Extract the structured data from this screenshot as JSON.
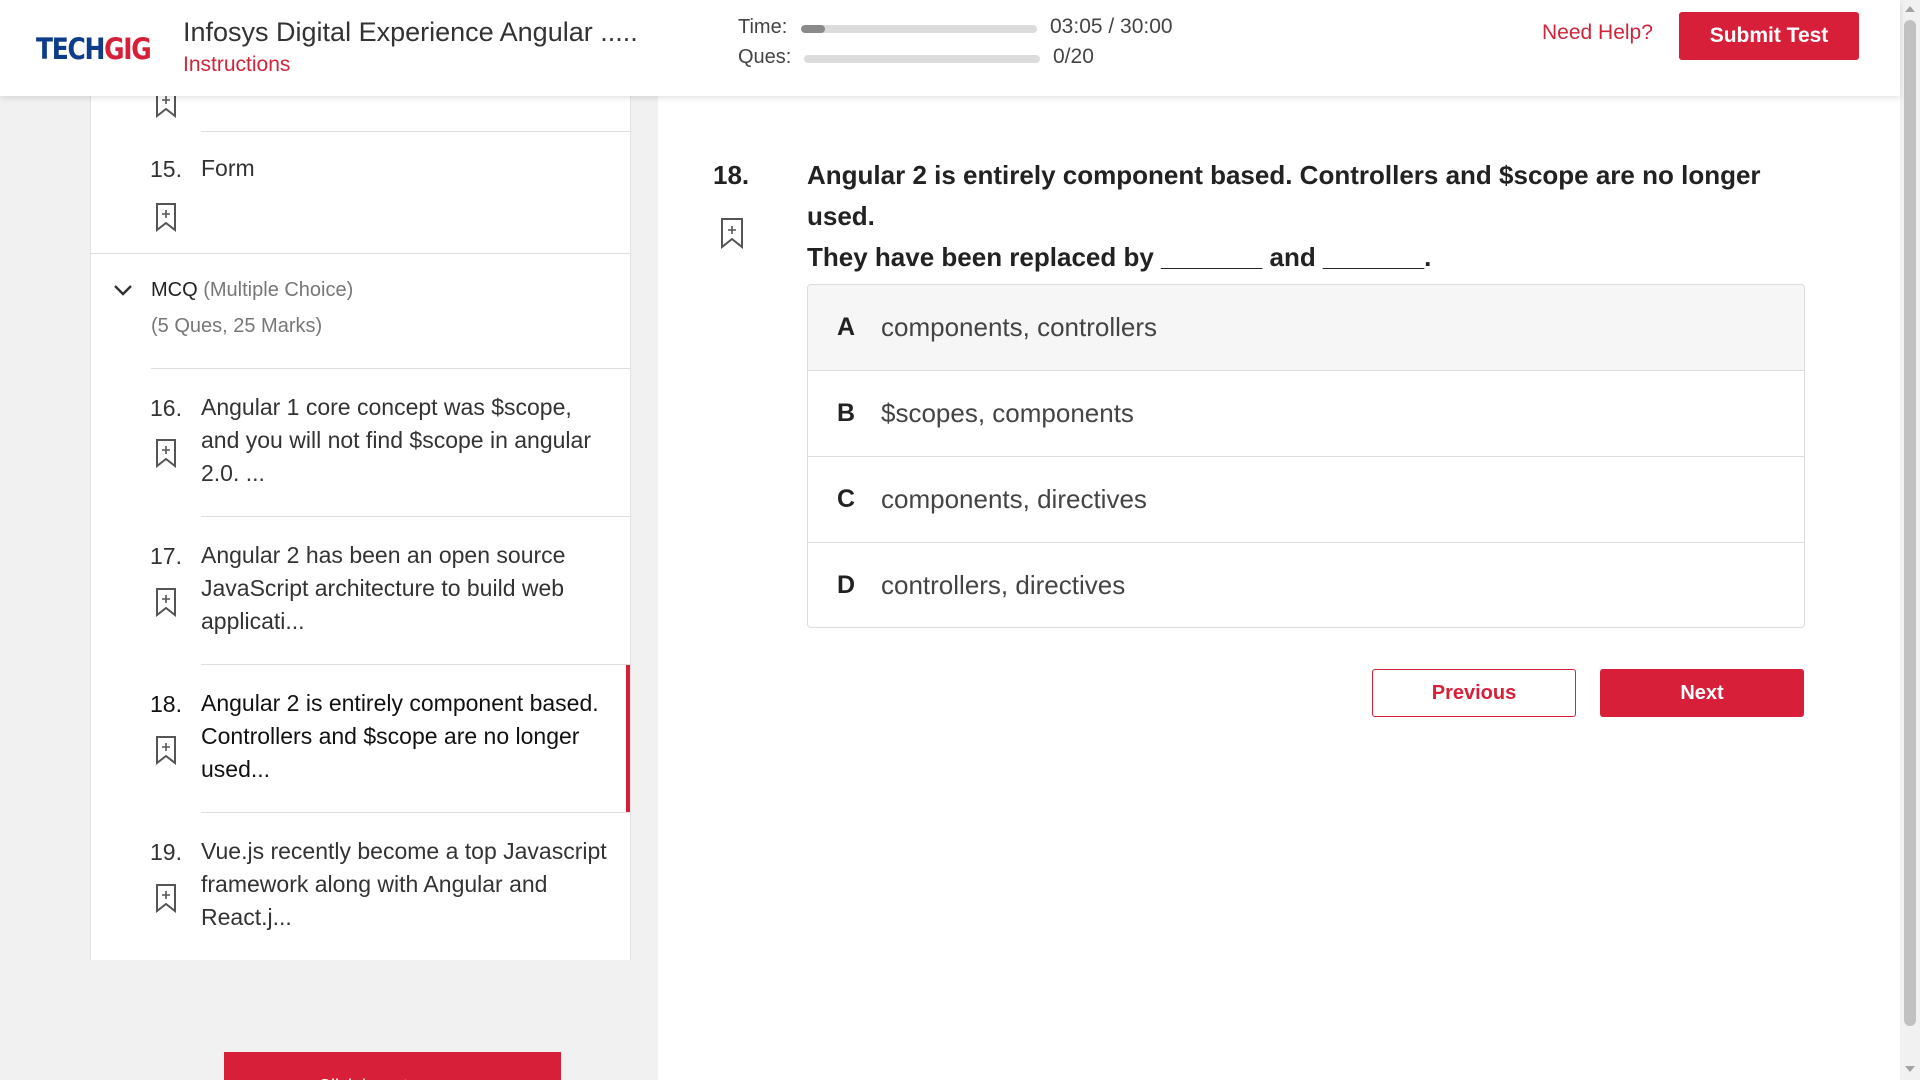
{
  "header": {
    "logo_part1": "TECH",
    "logo_part2": "GIG",
    "title": "Infosys Digital Experience Angular .....",
    "instructions_label": "Instructions",
    "time_label": "Time:",
    "time_value": "03:05 / 30:00",
    "time_progress": 0.1,
    "ques_label": "Ques:",
    "ques_value": "0/20",
    "ques_progress": 0,
    "help_label": "Need Help?",
    "submit_label": "Submit Test"
  },
  "sidebar": {
    "items_top": [
      {
        "num": "15.",
        "text": "Form"
      }
    ],
    "section": {
      "title": "MCQ",
      "title_suffix": "(Multiple Choice)",
      "subtitle": "(5 Ques, 25 Marks)"
    },
    "items": [
      {
        "num": "16.",
        "text": "Angular 1 core concept was $scope, and you will not find $scope in angular 2.0. ..."
      },
      {
        "num": "17.",
        "text": "Angular 2 has been an open source JavaScript architecture to build web applicati..."
      },
      {
        "num": "18.",
        "text": "Angular 2 is entirely component based. Controllers and $scope are no longer used...",
        "active": true
      },
      {
        "num": "19.",
        "text": "Vue.js recently become a top Javascript framework along with Angular and React.j..."
      }
    ],
    "move_button_label": "Click here to move"
  },
  "question": {
    "number": "18.",
    "text_line1": "Angular 2 is entirely component based. Controllers and $scope are no longer used.",
    "text_line2": "They have been replaced by _______ and _______.",
    "options": [
      {
        "letter": "A",
        "text": "components, controllers"
      },
      {
        "letter": "B",
        "text": "$scopes, components"
      },
      {
        "letter": "C",
        "text": "components, directives"
      },
      {
        "letter": "D",
        "text": "controllers, directives"
      }
    ]
  },
  "nav": {
    "previous_label": "Previous",
    "next_label": "Next"
  },
  "colors": {
    "accent": "#d71f3a",
    "logo_blue": "#0f3c8a"
  }
}
